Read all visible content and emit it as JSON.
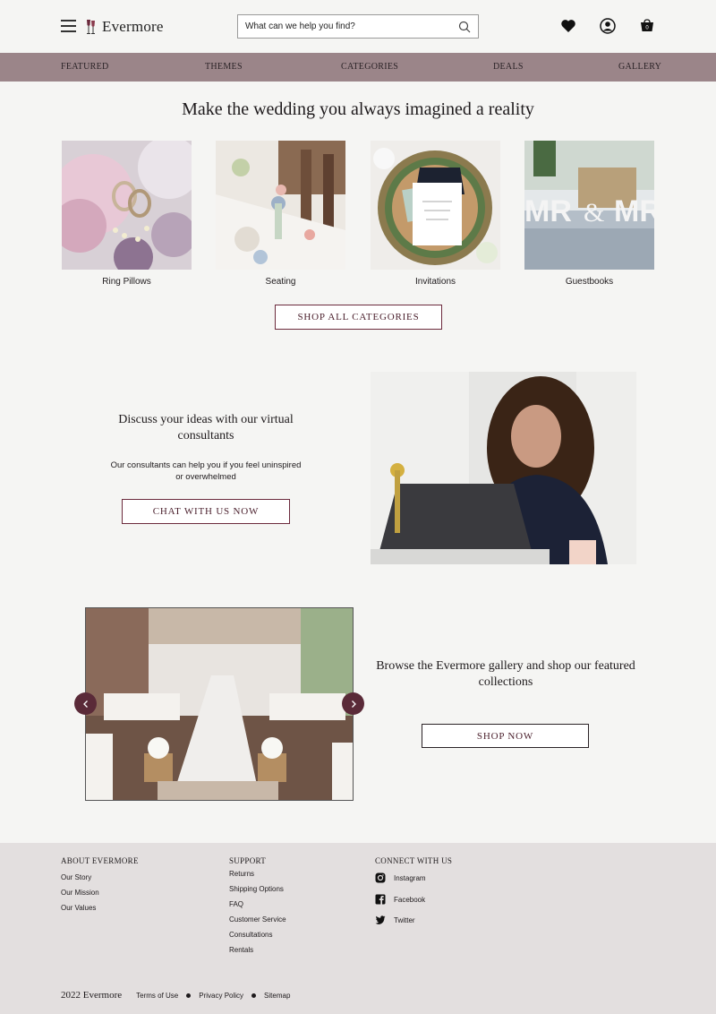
{
  "header": {
    "logo_text": "Evermore",
    "search_placeholder": "What can we help you find?",
    "cart_count": "0"
  },
  "nav": [
    "FEATURED",
    "THEMES",
    "CATEGORIES",
    "DEALS",
    "GALLERY"
  ],
  "hero": {
    "title": "Make the wedding you always imagined a reality"
  },
  "categories": [
    {
      "label": "Ring Pillows"
    },
    {
      "label": "Seating"
    },
    {
      "label": "Invitations"
    },
    {
      "label": "Guestbooks"
    }
  ],
  "shop_all_label": "SHOP ALL CATEGORIES",
  "consult": {
    "title": "Discuss your ideas with our virtual consultants",
    "text": "Our consultants can help you if you feel uninspired or overwhelmed",
    "button": "CHAT WITH US NOW"
  },
  "gallery": {
    "title": "Browse the Evermore gallery and shop our featured collections",
    "button": "SHOP NOW"
  },
  "footer": {
    "about": {
      "heading": "ABOUT EVERMORE",
      "links": [
        "Our Story",
        "Our Mission",
        "Our Values"
      ]
    },
    "support": {
      "heading": "SUPPORT",
      "links": [
        "Returns",
        "Shipping Options",
        "FAQ",
        "Customer Service",
        "Consultations",
        "Rentals"
      ]
    },
    "connect": {
      "heading": "CONNECT WITH US",
      "links": [
        "Instagram",
        "Facebook",
        "Twitter"
      ]
    },
    "copyright": "2022 Evermore",
    "legal": [
      "Terms of Use",
      "Privacy Policy",
      "Sitemap"
    ]
  },
  "colors": {
    "accent": "#9b8589",
    "button_border": "#6b2a3c",
    "footer_bg": "#e3dfdf",
    "page_bg": "#f5f5f3"
  }
}
